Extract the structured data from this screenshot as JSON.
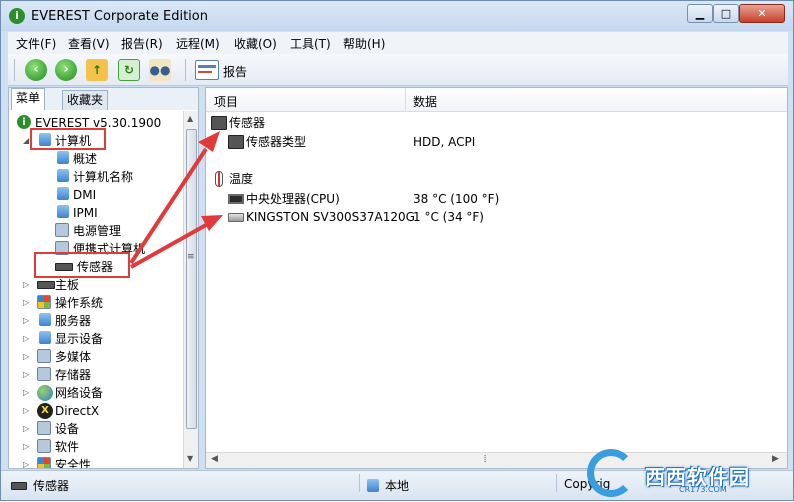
{
  "window": {
    "title": "EVEREST Corporate Edition",
    "min": "▁",
    "max": "□",
    "close": "✕"
  },
  "menu": [
    "文件(F)",
    "查看(V)",
    "报告(R)",
    "远程(M)",
    "收藏(O)",
    "工具(T)",
    "帮助(H)"
  ],
  "toolbar": {
    "report_label": "报告"
  },
  "left_tabs": [
    "菜单",
    "收藏夹"
  ],
  "tree": {
    "root": "EVEREST v5.30.1900",
    "computer": "计算机",
    "computer_children": [
      "概述",
      "计算机名称",
      "DMI",
      "IPMI",
      "电源管理",
      "便携式计算机",
      "传感器"
    ],
    "top_items": [
      "主板",
      "操作系统",
      "服务器",
      "显示设备",
      "多媒体",
      "存储器",
      "网络设备",
      "DirectX",
      "设备",
      "软件",
      "安全性"
    ]
  },
  "list": {
    "headers": [
      "项目",
      "数据"
    ],
    "groups": [
      {
        "title": "传感器",
        "rows": [
          {
            "label": "传感器类型",
            "value": "HDD, ACPI"
          }
        ]
      },
      {
        "title": "温度",
        "rows": [
          {
            "label": "中央处理器(CPU)",
            "value": "38 °C  (100 °F)"
          },
          {
            "label": "KINGSTON SV300S37A120G",
            "value": "1 °C  (34 °F)"
          }
        ]
      }
    ]
  },
  "status": {
    "left": "传感器",
    "middle": "本地",
    "right": "Copyrig"
  },
  "watermark": {
    "text": "西西软件园",
    "sub": "CR173.COM",
    "letter": "C"
  },
  "colors": {
    "annotation": "#e03a3a",
    "window_frame": "#cfe0f3"
  }
}
